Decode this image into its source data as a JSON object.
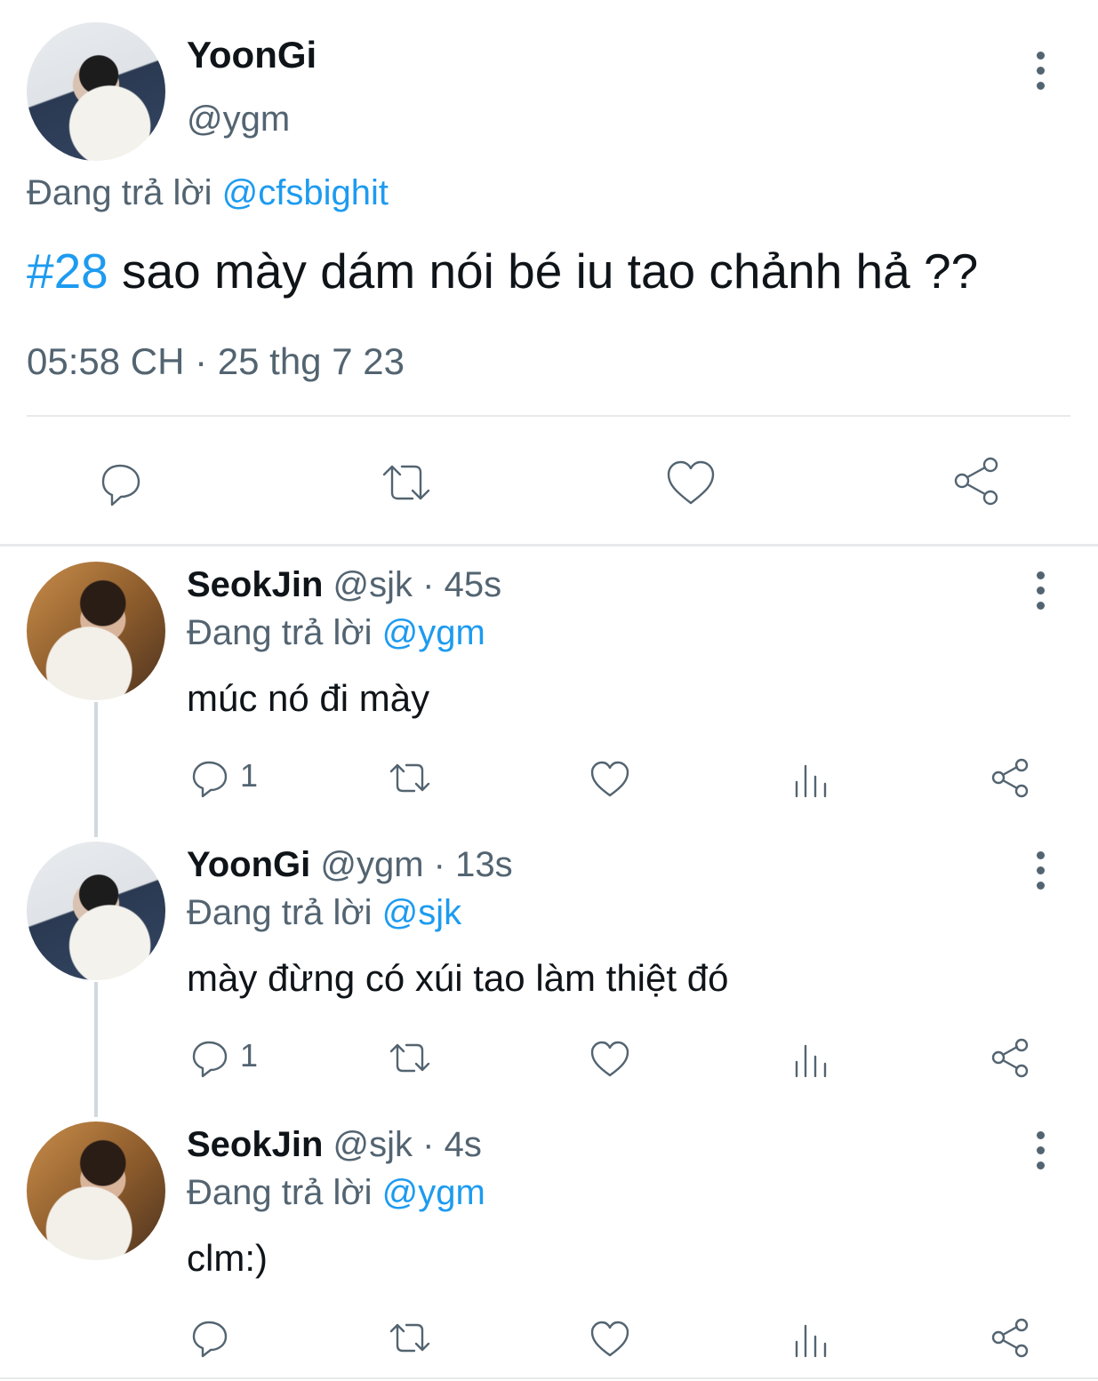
{
  "main_tweet": {
    "display_name": "YoonGi",
    "handle": "@ygm",
    "replying_prefix": "Đang trả lời",
    "replying_to": "@cfsbighit",
    "hashtag": "#28",
    "text": " sao mày dám nói bé iu tao chảnh hả ??",
    "timestamp": "05:58 CH · 25 thg 7 23",
    "avatar_icon": "avatar-yoongi"
  },
  "replies": [
    {
      "display_name": "SeokJin",
      "handle": "@sjk",
      "time": "· 45s",
      "replying_prefix": "Đang trả lời",
      "replying_to": "@ygm",
      "text": "múc nó đi mày",
      "reply_count": "1"
    },
    {
      "display_name": "YoonGi",
      "handle": "@ygm",
      "time": "· 13s",
      "replying_prefix": "Đang trả lời",
      "replying_to": "@sjk",
      "text": "mày đừng có xúi tao làm thiệt đó",
      "reply_count": "1"
    },
    {
      "display_name": "SeokJin",
      "handle": "@sjk",
      "time": "· 4s",
      "replying_prefix": "Đang trả lời",
      "replying_to": "@ygm",
      "text": "clm:)",
      "reply_count": ""
    }
  ],
  "colors": {
    "accent": "#1d9bf0",
    "secondary_text": "#536471",
    "divider": "#e7e9ea"
  },
  "icons": [
    "more-icon",
    "reply-icon",
    "retweet-icon",
    "like-icon",
    "views-icon",
    "share-icon"
  ]
}
